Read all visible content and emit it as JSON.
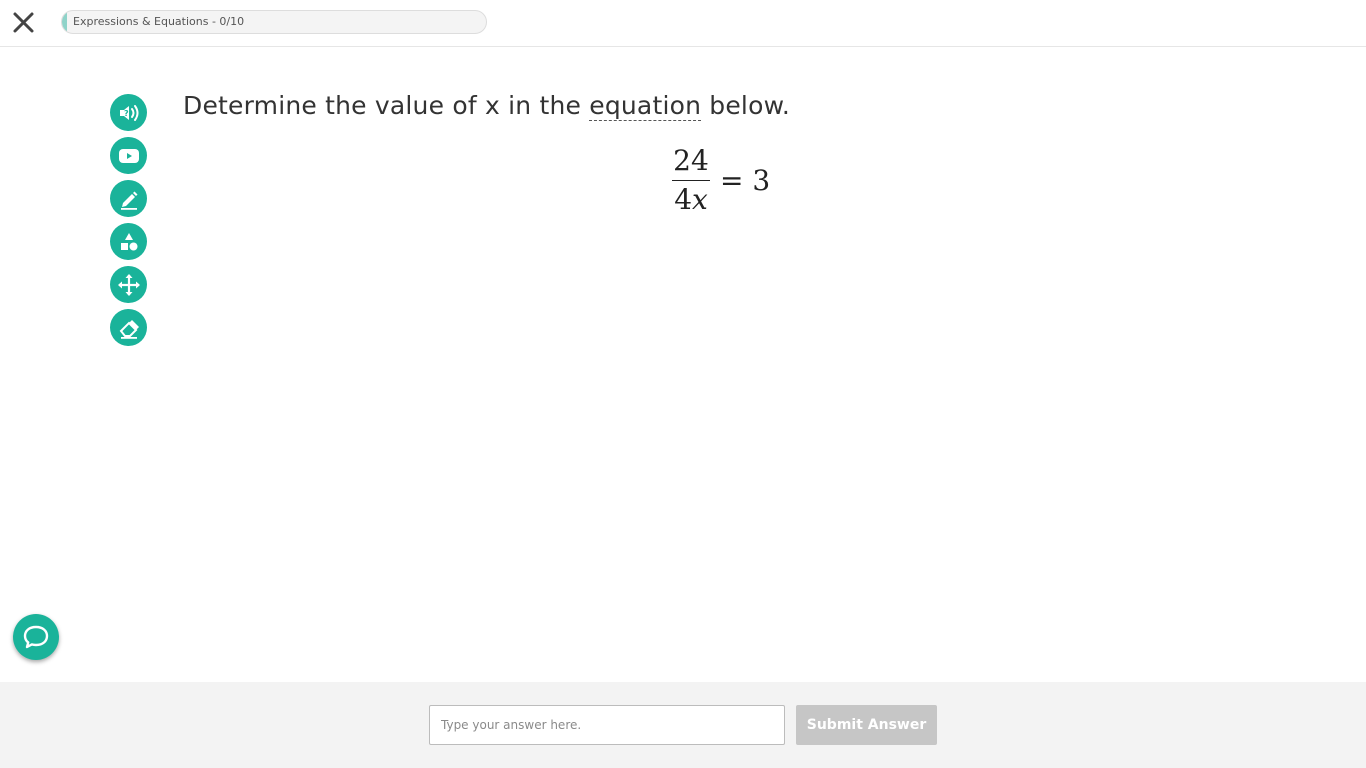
{
  "header": {
    "close_icon": "close-icon",
    "progress": {
      "label": "Expressions & Equations - 0/10",
      "fill_color": "#8fd3c9"
    }
  },
  "toolbar": {
    "accent_color": "#1ab39a",
    "tools": [
      {
        "icon": "read-aloud-icon"
      },
      {
        "icon": "video-icon"
      },
      {
        "icon": "pencil-icon"
      },
      {
        "icon": "shapes-icon"
      },
      {
        "icon": "move-icon"
      },
      {
        "icon": "eraser-icon"
      }
    ]
  },
  "question": {
    "text_before": "Determine the value of x in the ",
    "glossary_term": "equation",
    "text_after": " below."
  },
  "equation": {
    "numerator": "24",
    "denominator_coefficient": "4",
    "denominator_variable": "x",
    "equals": "= 3"
  },
  "chat": {
    "icon": "chat-bubble-icon"
  },
  "footer": {
    "answer_placeholder": "Type your answer here.",
    "answer_value": "",
    "submit_label": "Submit Answer",
    "submit_color": "#c6c6c6"
  }
}
